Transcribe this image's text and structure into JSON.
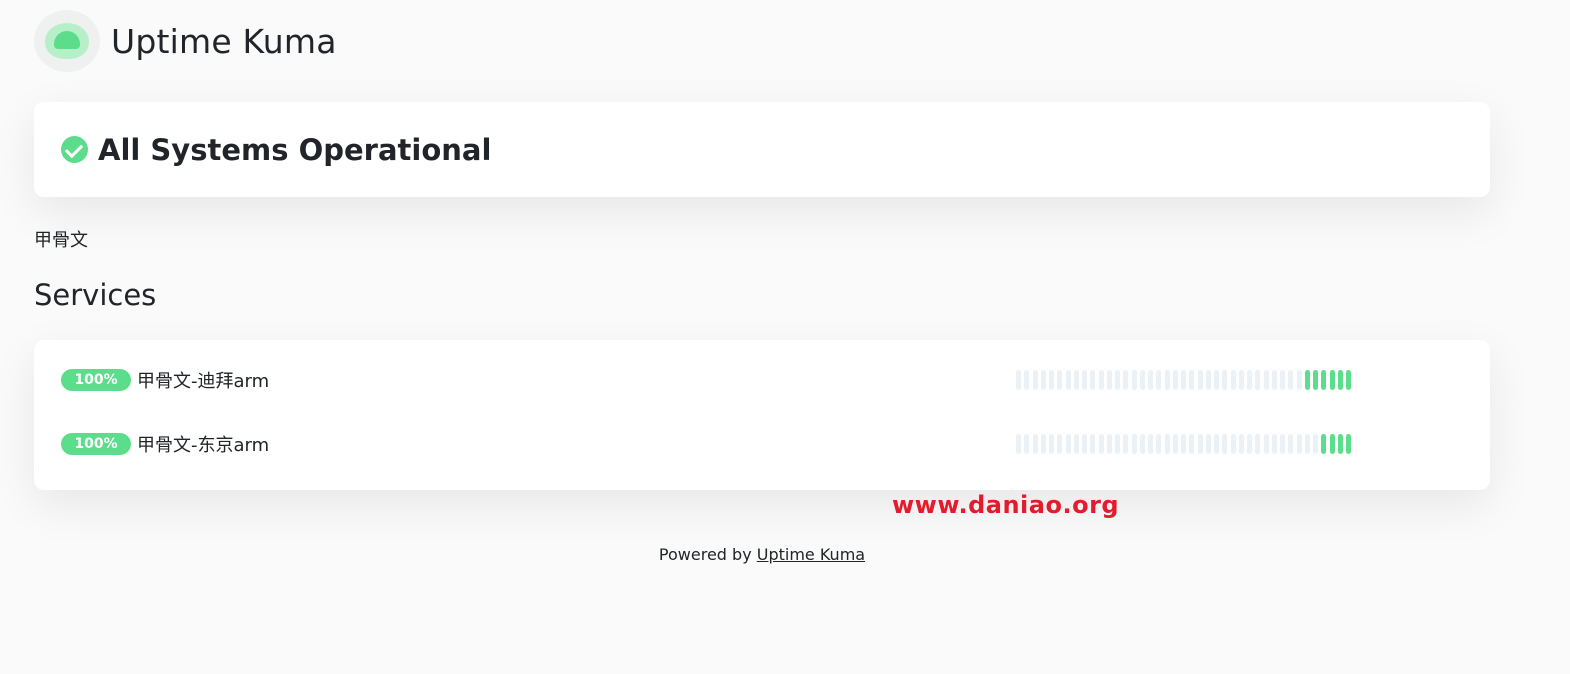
{
  "header": {
    "logo_icon": "uptime-kuma-logo-icon",
    "title": "Uptime Kuma"
  },
  "status": {
    "icon": "check-circle-icon",
    "text": "All Systems Operational",
    "color": "#5cdd8b"
  },
  "description": "甲骨文",
  "services": {
    "title": "Services",
    "monitors": [
      {
        "uptime": "100%",
        "name": "甲骨文-迪拜arm",
        "beats": 41,
        "beats_up": 6
      },
      {
        "uptime": "100%",
        "name": "甲骨文-东京arm",
        "beats": 41,
        "beats_up": 4
      }
    ]
  },
  "watermark": "www.daniao.org",
  "footer": {
    "prefix": "Powered by ",
    "link_text": "Uptime Kuma"
  },
  "colors": {
    "up": "#5cdd8b",
    "empty_beat": "#eaf1f7",
    "watermark": "#e21c2c"
  }
}
